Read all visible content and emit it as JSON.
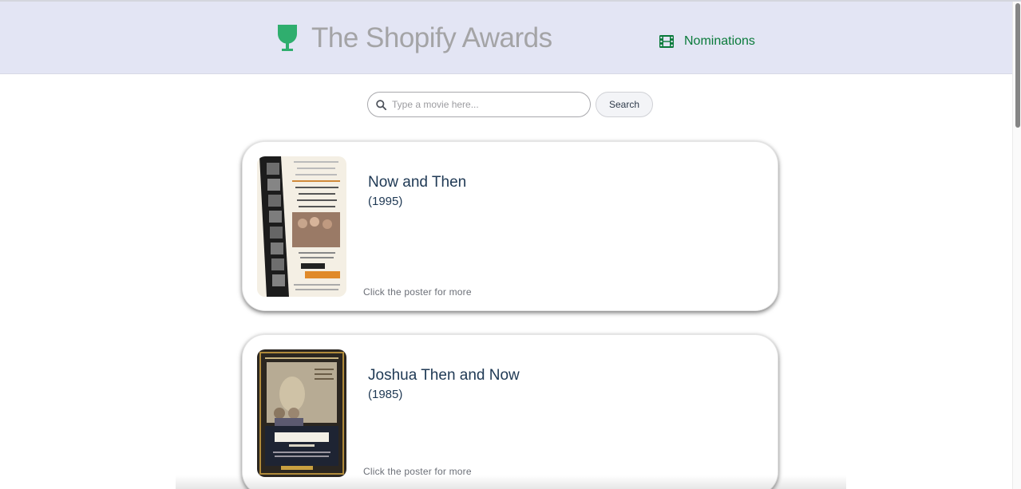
{
  "app": {
    "title": "The Shopify Awards",
    "logo_icon": "trophy-icon",
    "brand_color": "#2fae6e"
  },
  "nav": {
    "nominations_label": "Nominations",
    "nominations_icon": "film-icon",
    "link_color": "#0a7a3a"
  },
  "search": {
    "placeholder": "Type a movie here...",
    "value": "",
    "button_label": "Search",
    "icon": "search-icon"
  },
  "results": [
    {
      "title": "Now and Then",
      "year": "(1995)",
      "hint": "Click the poster for more"
    },
    {
      "title": "Joshua Then and Now",
      "year": "(1985)",
      "hint": "Click the poster for more"
    }
  ],
  "colors": {
    "header_bg": "#e3e5f4",
    "title_text": "#203a55"
  }
}
